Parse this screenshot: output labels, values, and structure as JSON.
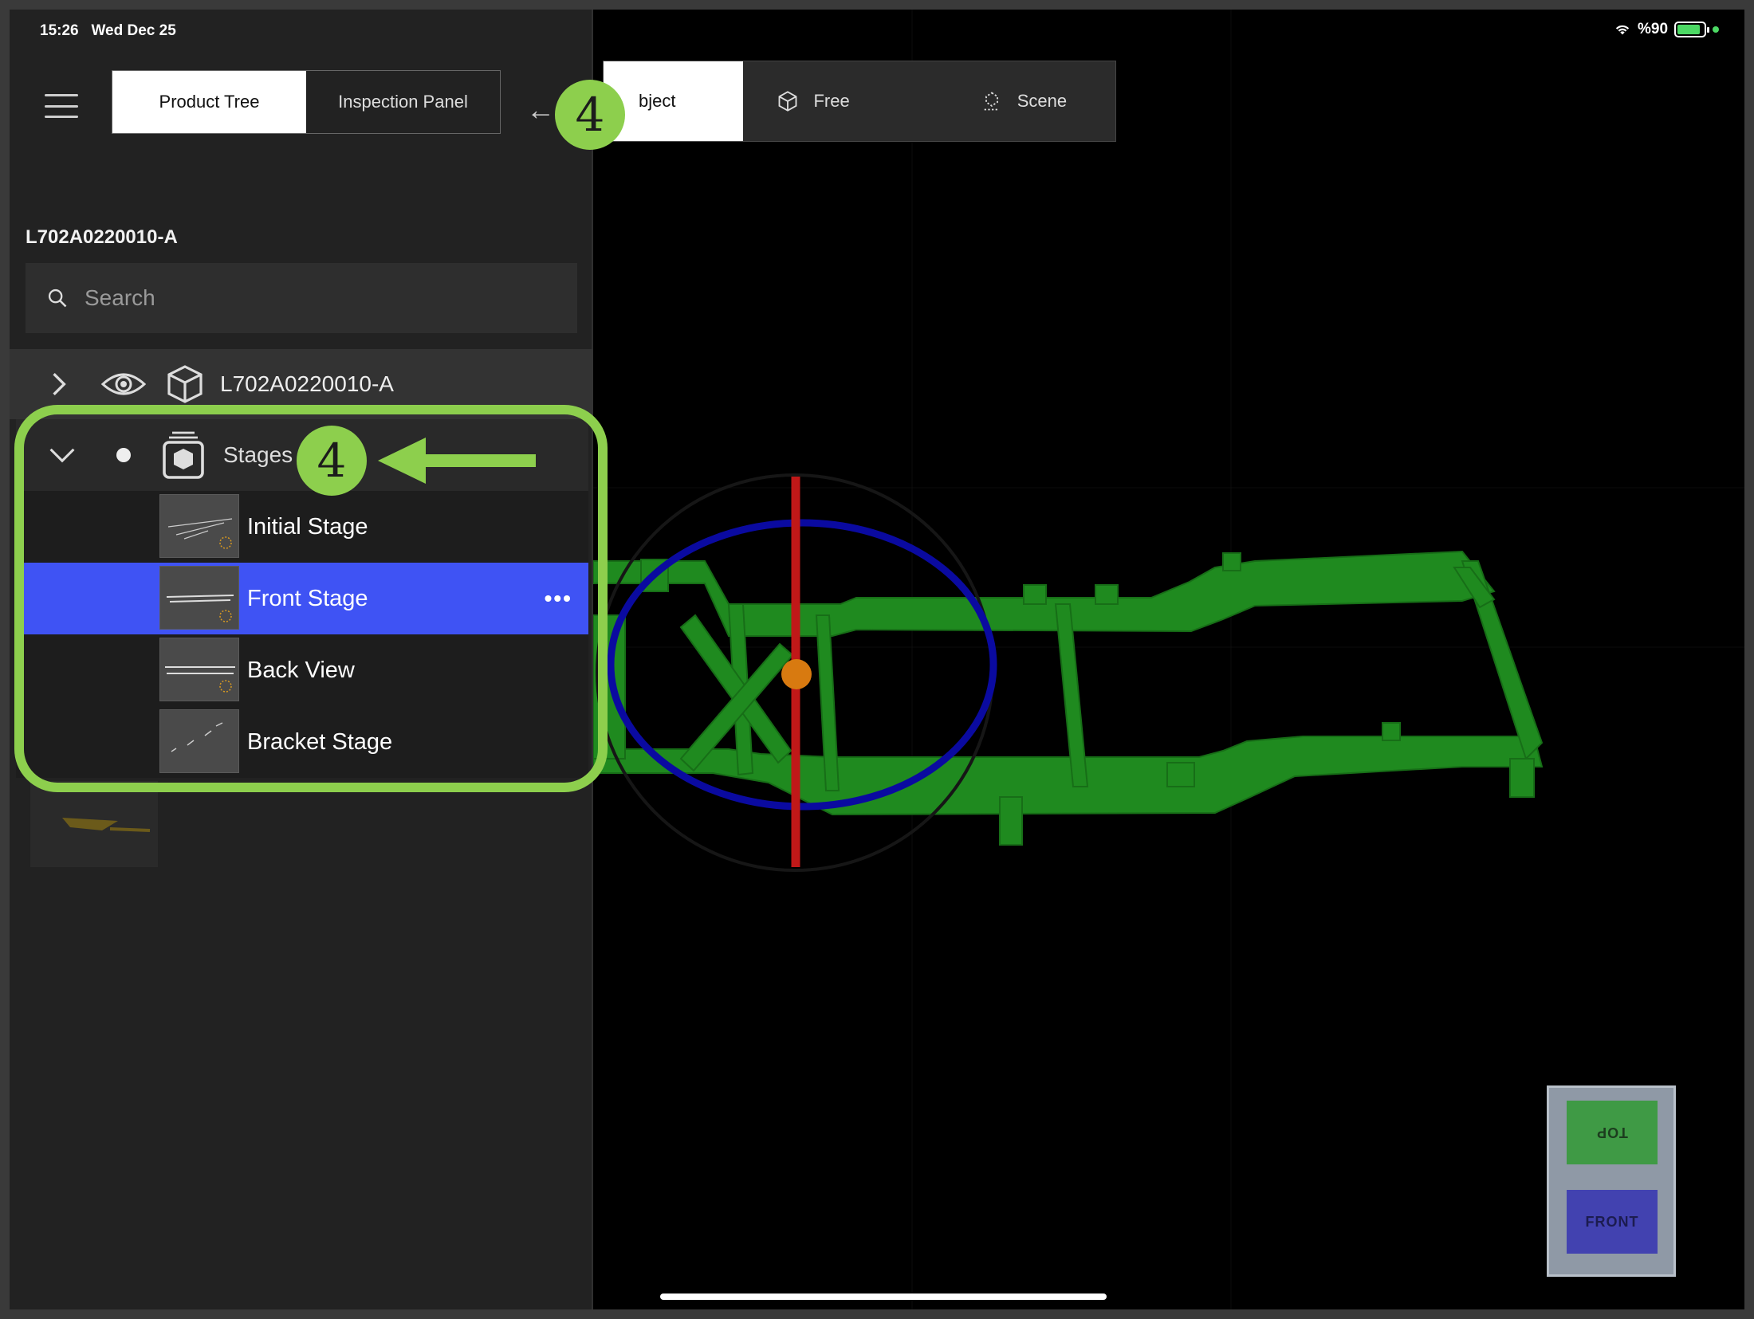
{
  "status_bar": {
    "time": "15:26",
    "date": "Wed Dec 25",
    "battery_text": "%90",
    "wifi_icon": "wifi-icon"
  },
  "header": {
    "menu_icon": "hamburger-menu-icon",
    "tabs": [
      {
        "label": "Product Tree",
        "active": true
      },
      {
        "label": "Inspection Panel",
        "active": false
      }
    ],
    "back_icon": "arrow-left-icon"
  },
  "view_modes": [
    {
      "label": "bject",
      "icon": "object-icon",
      "active": true
    },
    {
      "label": "Free",
      "icon": "cube-icon",
      "active": false
    },
    {
      "label": "Scene",
      "icon": "scene-icon",
      "active": false
    }
  ],
  "document": {
    "title": "L702A0220010-A"
  },
  "search": {
    "placeholder": "Search"
  },
  "tree": {
    "root": {
      "label": "L702A0220010-A",
      "expanded": false
    },
    "stages": {
      "label": "Stages",
      "expanded": true,
      "items": [
        {
          "label": "Initial Stage",
          "selected": false
        },
        {
          "label": "Front Stage",
          "selected": true,
          "more": "•••"
        },
        {
          "label": "Back View",
          "selected": false
        },
        {
          "label": "Bracket Stage",
          "selected": false
        }
      ]
    }
  },
  "view_cube": {
    "top_label": "TOP",
    "front_label": "FRONT"
  },
  "annotations": {
    "step_number_1": "4",
    "step_number_2": "4",
    "color": "#8dcf4d"
  },
  "colors": {
    "selected_row": "#3f53f4",
    "model": "#1f8a1f",
    "gizmo_red": "#c01818",
    "gizmo_blue": "#0a0aa0"
  }
}
